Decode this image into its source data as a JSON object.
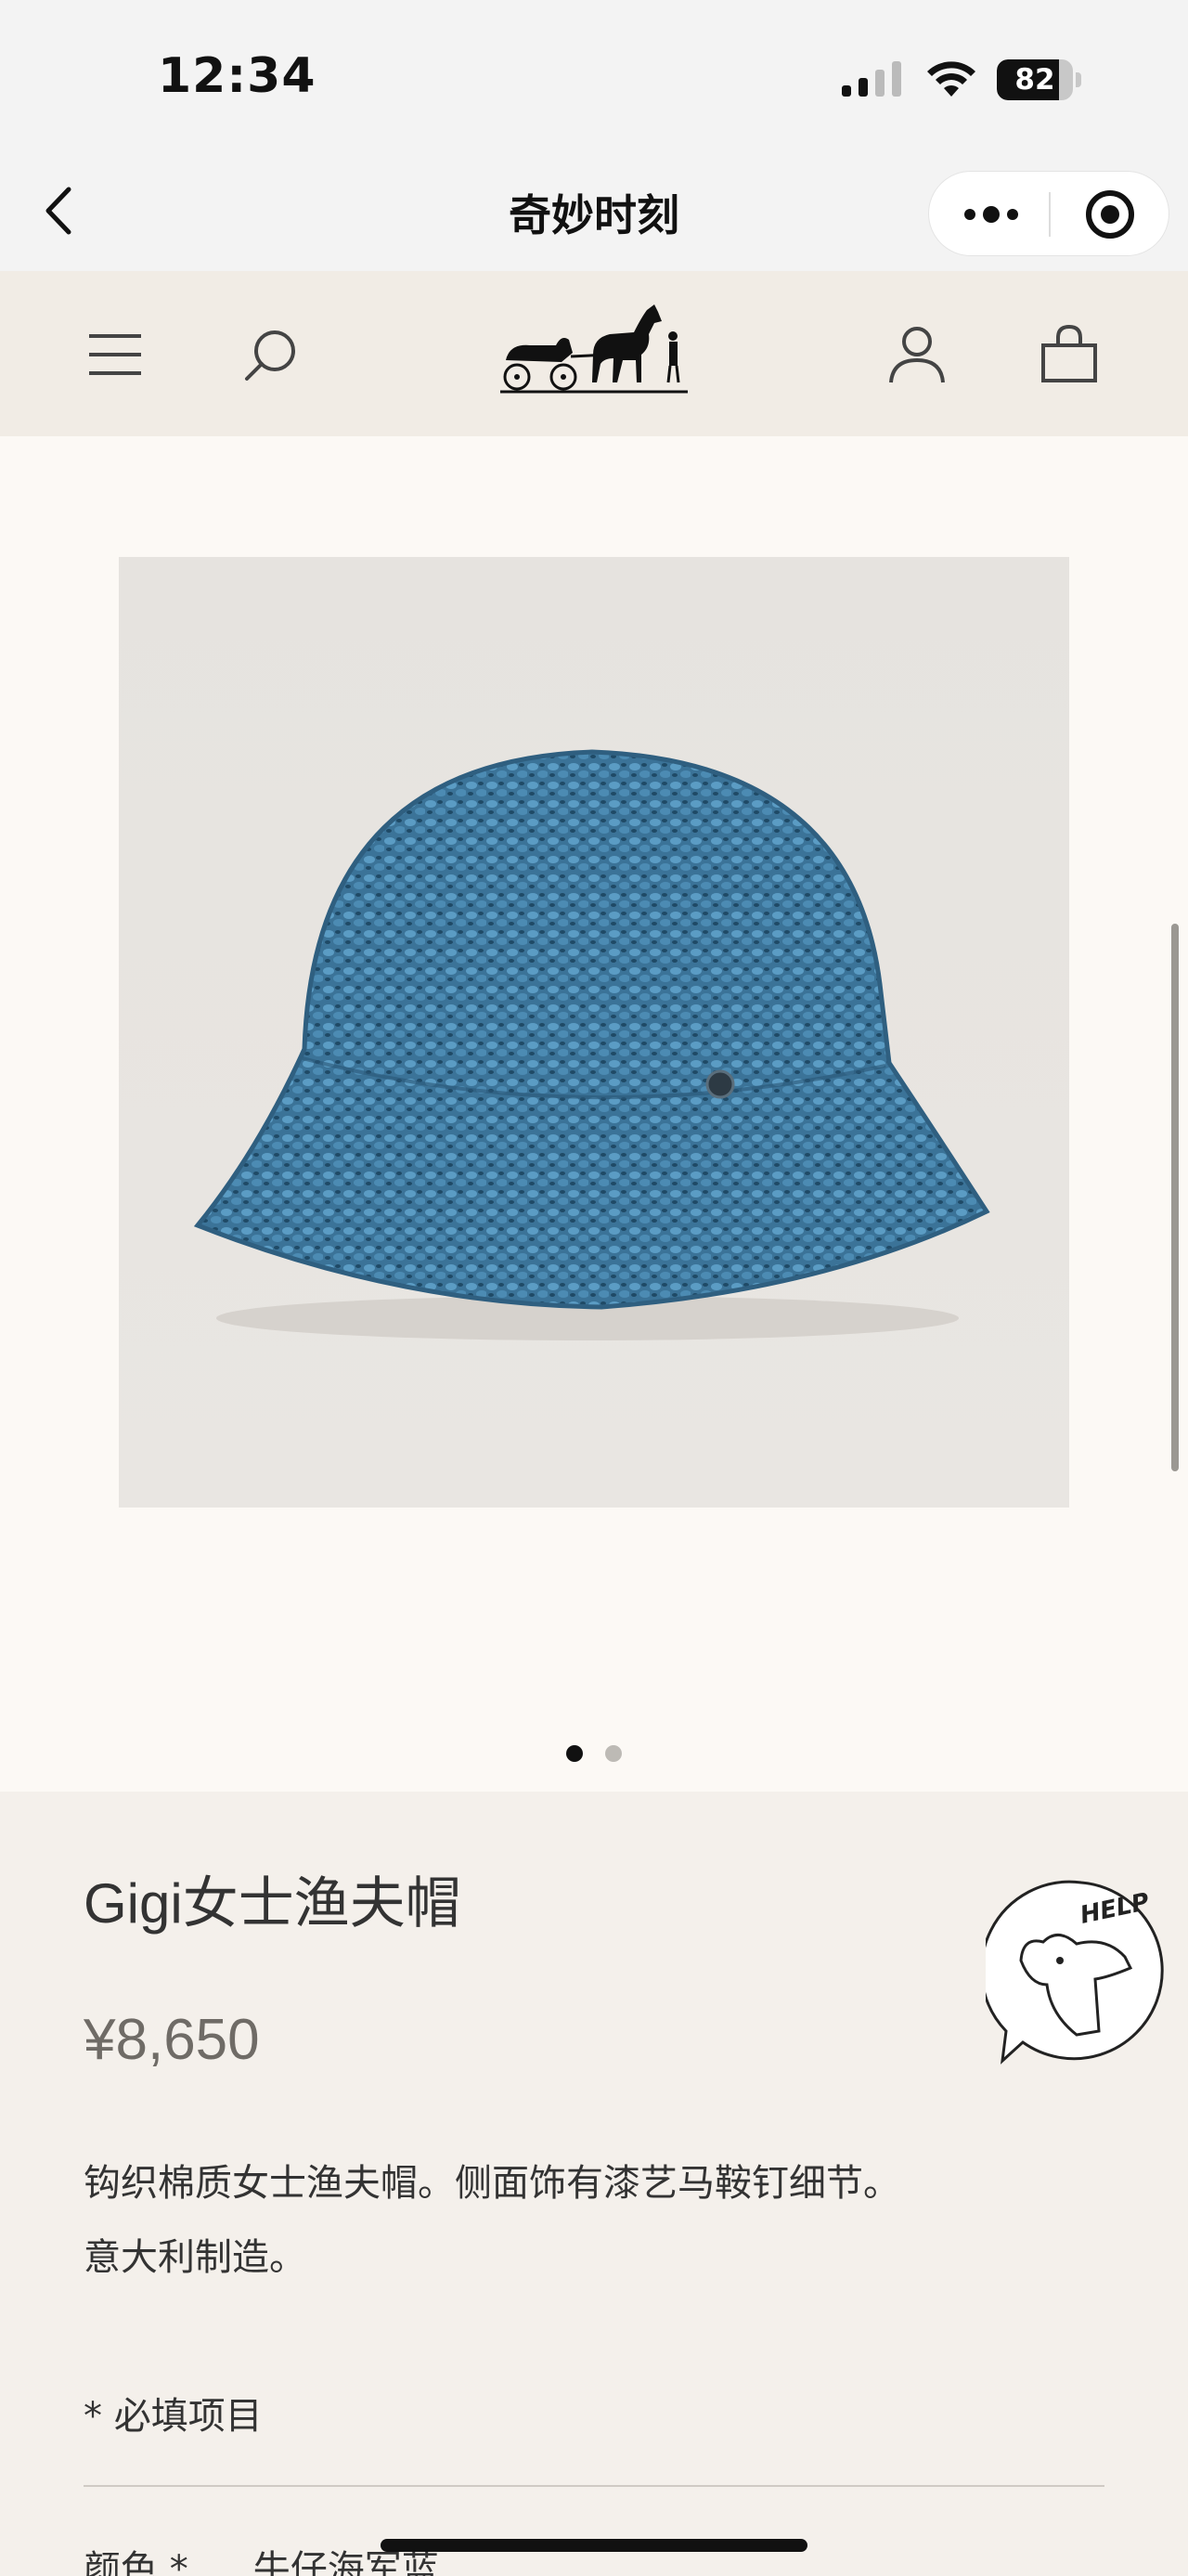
{
  "status_bar": {
    "time": "12:34",
    "battery_level": "82",
    "battery_fraction": 0.82,
    "icons": [
      "signal-icon",
      "wifi-icon",
      "battery-icon"
    ]
  },
  "title_bar": {
    "title": "奇妙时刻",
    "icons": [
      "back-arrow-icon",
      "more-dots-icon",
      "close-target-icon"
    ]
  },
  "site_header": {
    "icons": [
      "menu-icon",
      "search-icon",
      "brand-logo-carriage",
      "account-icon",
      "shopping-bag-icon"
    ]
  },
  "gallery": {
    "image": "crochet-bucket-hat",
    "image_count": 2,
    "active_index": 0,
    "image_color": "#3f7a9e"
  },
  "product": {
    "name": "Gigi女士渔夫帽",
    "price": "¥8,650",
    "description_line1": "钩织棉质女士渔夫帽。侧面饰有漆艺马鞍钉细节。",
    "description_line2": "意大利制造。",
    "required_note": "* 必填项目",
    "color_label": "颜色 *",
    "color_value": "牛仔海军蓝"
  },
  "help": {
    "label": "HELP"
  },
  "colors": {
    "page_bg": "#f4f0eb",
    "header_bg": "#f1ece5",
    "gallery_bg": "#fcf9f5",
    "status_bg": "#f3f3f3"
  }
}
